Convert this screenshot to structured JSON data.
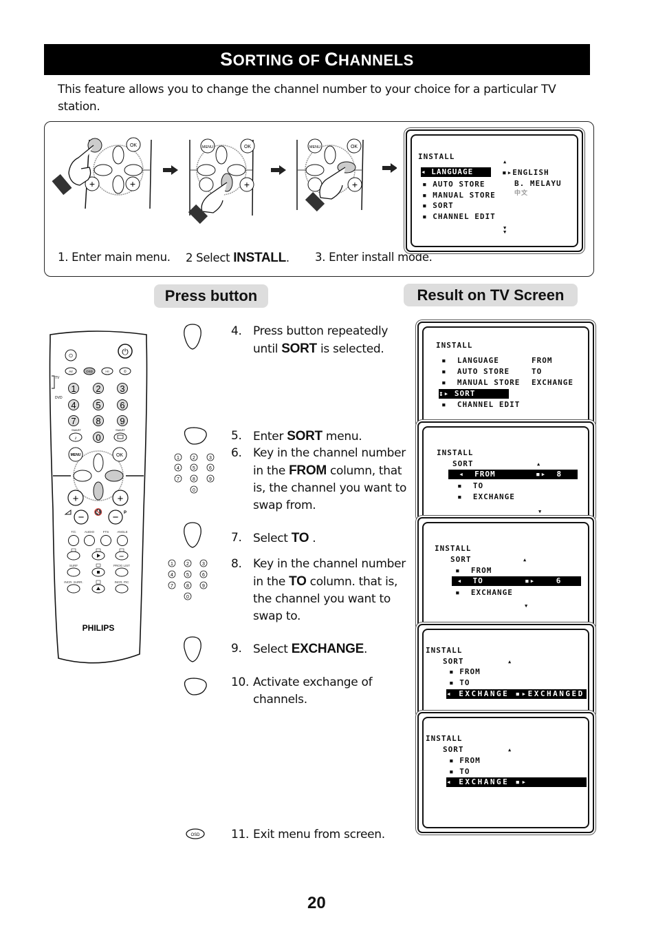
{
  "page": {
    "title_first": "S",
    "title_rest1": "ORTING OF ",
    "title_second": "C",
    "title_rest2": "HANNELS",
    "intro": "This feature allows you to change the channel number to your choice for a particular TV station.",
    "page_number": "20"
  },
  "top_steps": [
    {
      "num": "1.",
      "text": "Enter main menu.",
      "bold": ""
    },
    {
      "num": "2",
      "text_before": "Select ",
      "bold": "INSTALL",
      "text_after": "."
    },
    {
      "num": "3.",
      "text": "Enter install mode.",
      "bold": ""
    }
  ],
  "top_osd": {
    "header": "INSTALL",
    "items": [
      "LANGUAGE",
      "AUTO STORE",
      "MANUAL STORE",
      "SORT",
      "CHANNEL EDIT"
    ],
    "selected_index": 0,
    "options": [
      "ENGLISH",
      "B. MELAYU",
      "中文"
    ]
  },
  "headers": {
    "press_button": "Press button",
    "result": "Result on TV Screen"
  },
  "remote": {
    "brand": "PHILIPS",
    "top_buttons": [
      "AV",
      "OSD",
      "I-II",
      "⏲"
    ],
    "digits": [
      "1",
      "2",
      "3",
      "4",
      "5",
      "6",
      "7",
      "8",
      "9",
      "0"
    ],
    "smart_label": "SMART",
    "menu_label": "MENU",
    "ok_label": "OK",
    "func_labels": [
      "T/C",
      "AUDIO",
      "FTS",
      "ANGLE"
    ],
    "row_labels": [
      "SURF",
      "PROG LIST",
      "INCR. SURR.",
      "INCR. PIC"
    ],
    "switch_labels": [
      "TV",
      "DVD"
    ]
  },
  "instructions": [
    {
      "num": "4.",
      "parts": [
        "Press button repeatedly until ",
        "SORT",
        " is selected."
      ]
    },
    {
      "num": "5.",
      "parts": [
        "Enter ",
        "SORT",
        " menu."
      ]
    },
    {
      "num": "6.",
      "parts": [
        "Key in the channel number in the ",
        "FROM",
        " column, that is, the channel you want to swap from."
      ]
    },
    {
      "num": "7.",
      "parts": [
        "Select ",
        "TO",
        " ."
      ]
    },
    {
      "num": "8.",
      "parts": [
        "Key in the channel number in the ",
        "TO",
        " column. that is, the channel you want to swap to."
      ]
    },
    {
      "num": "9.",
      "parts": [
        "Select ",
        "EXCHANGE",
        "."
      ]
    },
    {
      "num": "10.",
      "parts": [
        "Activate exchange of channels.",
        "",
        ""
      ]
    },
    {
      "num": "11.",
      "parts": [
        "Exit menu from screen.",
        "",
        ""
      ]
    }
  ],
  "osd_label": "OSD",
  "screens": [
    {
      "header": "INSTALL",
      "items": [
        "LANGUAGE",
        "AUTO STORE",
        "MANUAL STORE",
        "SORT",
        "CHANNEL EDIT"
      ],
      "right": [
        "FROM",
        "TO",
        "EXCHANGE"
      ],
      "selected": "SORT"
    },
    {
      "header": "INSTALL",
      "sub": "SORT",
      "items": [
        "FROM",
        "TO",
        "EXCHANGE"
      ],
      "selected": "FROM",
      "value": "8"
    },
    {
      "header": "INSTALL",
      "sub": "SORT",
      "items": [
        "FROM",
        "TO",
        "EXCHANGE"
      ],
      "selected": "TO",
      "value": "6"
    },
    {
      "header": "INSTALL",
      "sub": "SORT",
      "items": [
        "FROM",
        "TO",
        "EXCHANGE"
      ],
      "selected": "EXCHANGE",
      "value": "EXCHANGED"
    },
    {
      "header": "INSTALL",
      "sub": "SORT",
      "items": [
        "FROM",
        "TO",
        "EXCHANGE"
      ],
      "selected": "EXCHANGE",
      "value": ""
    }
  ]
}
